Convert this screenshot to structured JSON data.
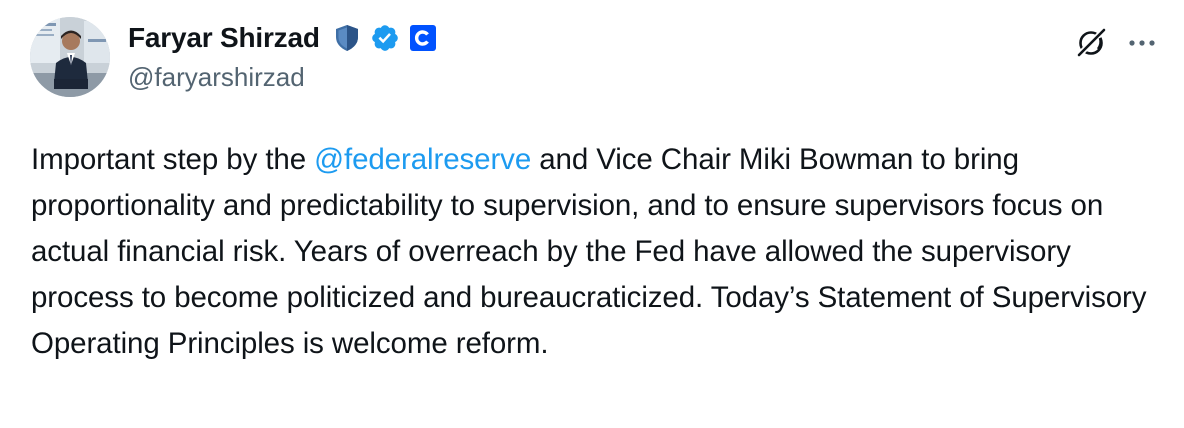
{
  "author": {
    "display_name": "Faryar Shirzad",
    "handle": "@faryarshirzad",
    "badges": [
      "affiliate-shield-icon",
      "verified-check-icon",
      "coinbase-logo-icon"
    ]
  },
  "actions": {
    "grok_icon": "grok-icon",
    "more_icon": "more-icon"
  },
  "tweet": {
    "text_before_mention": "Important step by the ",
    "mention": "@federalreserve",
    "text_after_mention": " and Vice Chair Miki Bowman to bring proportionality and predictability to supervision, and to ensure supervisors focus on actual financial risk. Years of overreach by the Fed have allowed the supervisory process to become politicized and bureaucraticized. Today’s Statement of Supervisory Operating Principles is welcome reform."
  },
  "colors": {
    "text": "#0f1419",
    "secondary": "#536471",
    "link": "#1d9bf0",
    "verified": "#1d9bf0",
    "coinbase": "#0052ff",
    "shield": "#3f6fa6"
  }
}
